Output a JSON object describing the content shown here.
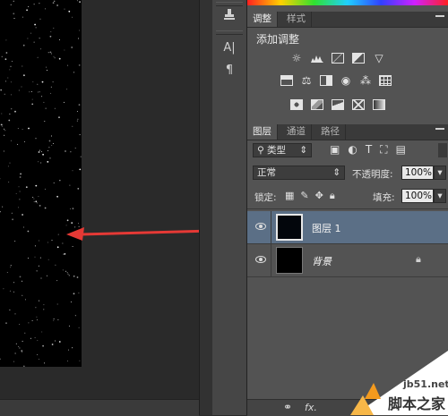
{
  "colors": {
    "arrow": "#e53935",
    "selected_row": "#5b6f86",
    "panel_bg": "#535353"
  },
  "toolbar_icons": [
    "stamp-icon",
    "character-icon",
    "paragraph-icon"
  ],
  "adjustments": {
    "tab_adjust": "调整",
    "tab_styles": "样式",
    "heading": "添加调整",
    "icons": [
      "brightness-icon",
      "levels-icon",
      "curves-icon",
      "exposure-icon",
      "vibrance-icon",
      "hue-icon",
      "color-balance-icon",
      "black-white-icon",
      "photo-filter-icon",
      "channel-mixer-icon",
      "color-lookup-icon",
      "invert-icon",
      "posterize-icon",
      "threshold-icon",
      "selective-color-icon",
      "gradient-map-icon"
    ]
  },
  "layers_panel": {
    "tab_layers": "图层",
    "tab_channels": "通道",
    "tab_paths": "路径",
    "filter_kind": "类型",
    "blend_mode": "正常",
    "opacity_label": "不透明度:",
    "opacity_value": "100%",
    "lock_label": "锁定:",
    "fill_label": "填充:",
    "fill_value": "100%",
    "layers": [
      {
        "name": "图层 1",
        "selected": true,
        "locked": false
      },
      {
        "name": "背景",
        "selected": false,
        "locked": true
      }
    ],
    "footer_link": "⚭",
    "footer_fx": "fx."
  },
  "watermark": {
    "url": "jb51.net",
    "site": "脚本之家"
  }
}
